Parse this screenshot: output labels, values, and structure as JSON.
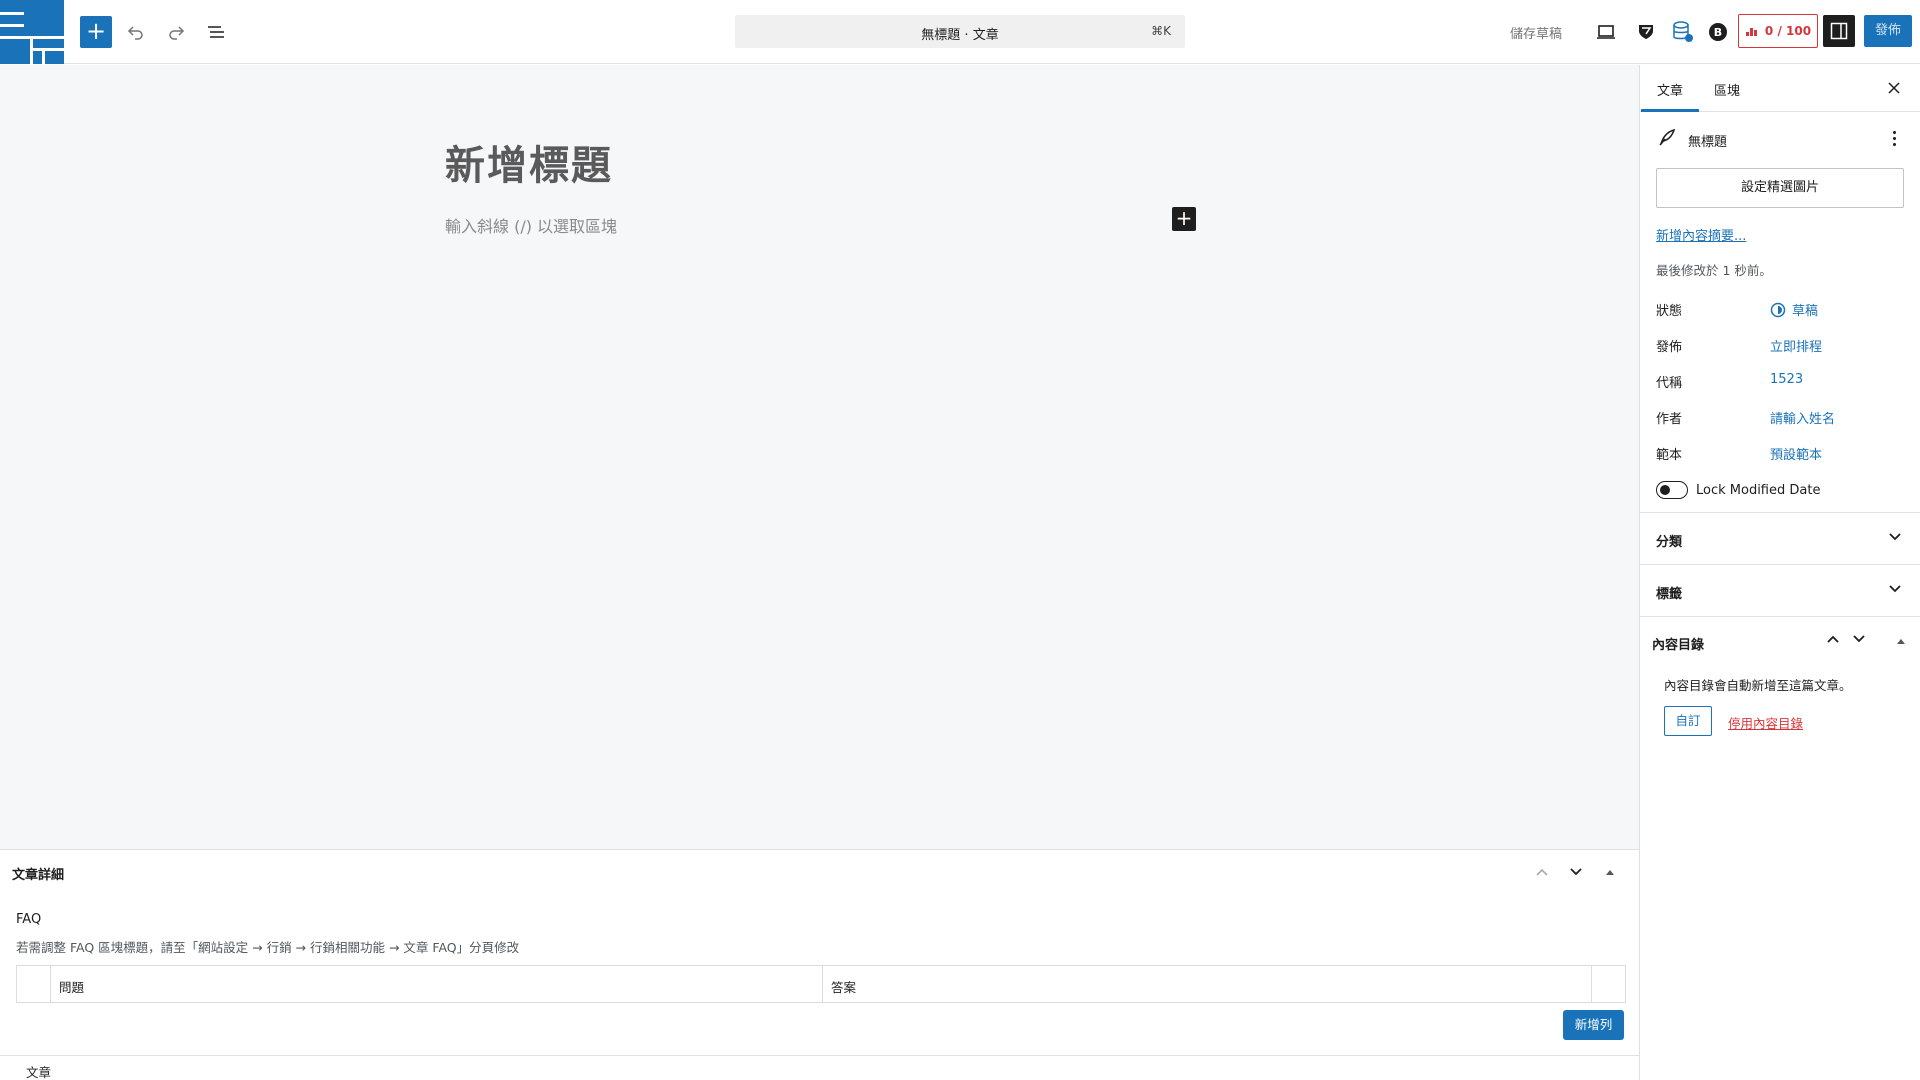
{
  "toolbar": {
    "command_title": "無標題 · 文章",
    "command_shortcut": "⌘K",
    "save_draft_label": "儲存草稿",
    "seo_score": "0 / 100",
    "publish_label": "發佈"
  },
  "editor": {
    "title_placeholder": "新增標題",
    "block_placeholder": "輸入斜線 (/) 以選取區塊"
  },
  "metabox": {
    "title": "文章詳細",
    "faq_title": "FAQ",
    "faq_desc": "若需調整 FAQ 區塊標題，請至「網站設定 → 行銷 → 行銷相關功能 → 文章 FAQ」分頁修改",
    "col_question": "問題",
    "col_answer": "答案",
    "add_row_label": "新增列"
  },
  "breadcrumb": {
    "label": "文章"
  },
  "sidebar": {
    "tabs": [
      {
        "label": "文章"
      },
      {
        "label": "區塊"
      }
    ],
    "post_title": "無標題",
    "featured_image_label": "設定精選圖片",
    "excerpt_link": "新增內容摘要...",
    "last_modified": "最後修改於 1 秒前。",
    "rows": [
      {
        "label": "狀態",
        "value": "草稿"
      },
      {
        "label": "發佈",
        "value": "立即排程"
      },
      {
        "label": "代稱",
        "value": "1523"
      },
      {
        "label": "作者",
        "value": "請輸入姓名"
      },
      {
        "label": "範本",
        "value": "預設範本"
      }
    ],
    "lock_modified_label": "Lock Modified Date",
    "lock_modified_on": false,
    "panels": [
      {
        "label": "分類"
      },
      {
        "label": "標籤"
      }
    ],
    "toc": {
      "title": "內容目錄",
      "desc": "內容目錄會自動新增至這篇文章。",
      "custom_label": "自訂",
      "disable_label": "停用內容目錄"
    }
  },
  "colors": {
    "accent": "#1a73b8",
    "danger": "#d63638",
    "canvas_bg": "#f6f7f9"
  }
}
